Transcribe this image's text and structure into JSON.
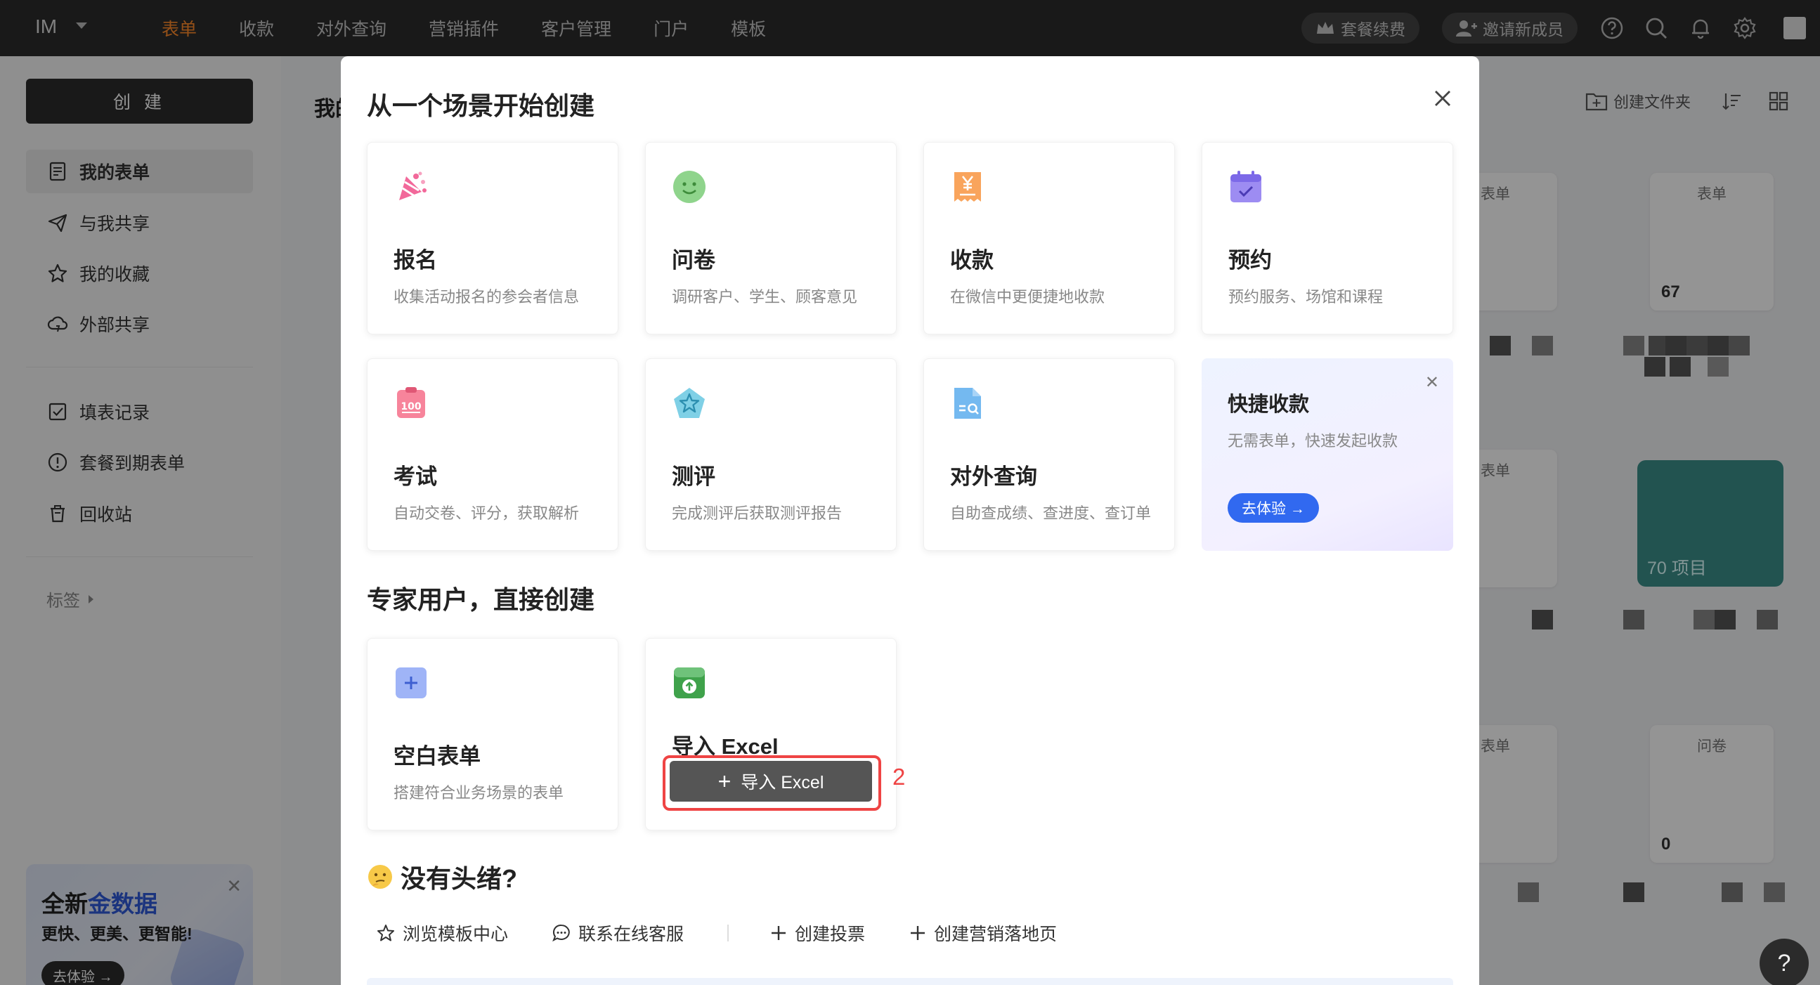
{
  "topbar": {
    "logo": "IM",
    "nav": [
      "表单",
      "收款",
      "对外查询",
      "营销插件",
      "客户管理",
      "门户",
      "模板"
    ],
    "renew_label": "套餐续费",
    "invite_label": "邀请新成员",
    "icons": [
      "help-circle-icon",
      "search-icon",
      "bell-icon",
      "gear-icon"
    ]
  },
  "sidebar": {
    "create_label": "创 建",
    "items": [
      "我的表单",
      "与我共享",
      "我的收藏",
      "外部共享"
    ],
    "items2": [
      "填表记录",
      "套餐到期表单",
      "回收站"
    ],
    "tags_label": "标签",
    "promo": {
      "title_a": "全新",
      "title_b": "金数据",
      "subtitle": "更快、更美、更智能!",
      "button": "去体验 →"
    }
  },
  "main": {
    "title": "我的",
    "create_folder_label": "创建文件夹",
    "cards": [
      {
        "label": "表单",
        "count": ""
      },
      {
        "label": "表单",
        "count": "67"
      },
      {
        "label": "表单",
        "count": ""
      },
      {
        "label": "表单",
        "count": ""
      },
      {
        "label": "问卷",
        "count": "0"
      }
    ],
    "folder_label": "70 项目"
  },
  "modal": {
    "title": "从一个场景开始创建",
    "scenes": [
      {
        "title": "报名",
        "desc": "收集活动报名的参会者信息",
        "icon": "party-popper-icon"
      },
      {
        "title": "问卷",
        "desc": "调研客户、学生、顾客意见",
        "icon": "smiley-icon"
      },
      {
        "title": "收款",
        "desc": "在微信中更便捷地收款",
        "icon": "yuan-receipt-icon"
      },
      {
        "title": "预约",
        "desc": "预约服务、场馆和课程",
        "icon": "calendar-check-icon"
      },
      {
        "title": "考试",
        "desc": "自动交卷、评分，获取解析",
        "icon": "exam-score-icon"
      },
      {
        "title": "测评",
        "desc": "完成测评后获取测评报告",
        "icon": "pentagon-star-icon"
      },
      {
        "title": "对外查询",
        "desc": "自助查成绩、查进度、查订单",
        "icon": "doc-search-icon"
      }
    ],
    "quick_pay": {
      "title": "快捷收款",
      "desc": "无需表单，快速发起收款",
      "button": "去体验 →"
    },
    "expert_title": "专家用户，直接创建",
    "blank": {
      "title": "空白表单",
      "desc": "搭建符合业务场景的表单"
    },
    "excel": {
      "title": "导入 Excel",
      "button": "导入 Excel"
    },
    "annotation_number": "2",
    "no_idea_title": "没有头绪?",
    "links": [
      "浏览模板中心",
      "联系在线客服",
      "创建投票",
      "创建营销落地页"
    ]
  },
  "help_label": "?",
  "colors": {
    "accent": "#ff8a2a",
    "primary": "#3169f0",
    "highlight": "#ef4444",
    "dark": "#2b2b2b"
  }
}
